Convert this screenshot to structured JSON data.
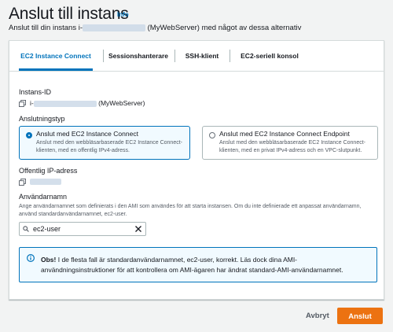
{
  "header": {
    "title": "Anslut till instans",
    "info_link": "Info",
    "subtitle_prefix": "Anslut till din instans i-",
    "subtitle_suffix": "(MyWebServer) med något av dessa alternativ"
  },
  "tabs": [
    {
      "label": "EC2 Instance Connect",
      "active": true
    },
    {
      "label": "Sessionshanterare",
      "active": false
    },
    {
      "label": "SSH-klient",
      "active": false
    },
    {
      "label": "EC2-seriell konsol",
      "active": false
    }
  ],
  "instance": {
    "label": "Instans-ID",
    "id_prefix": "i-",
    "name": "(MyWebServer)"
  },
  "connection_type": {
    "label": "Anslutningstyp",
    "options": [
      {
        "title": "Anslut med EC2 Instance Connect",
        "description": "Anslut med den webbläsarbaserade EC2 Instance Connect-klienten, med en offentlig IPv4-adress.",
        "selected": true
      },
      {
        "title": "Anslut med EC2 Instance Connect Endpoint",
        "description": "Anslut med den webbläsarbaserade EC2 Instance Connect-klienten, med en privat IPv4-adress och en VPC-slutpunkt.",
        "selected": false
      }
    ]
  },
  "public_ip": {
    "label": "Offentlig IP-adress"
  },
  "username": {
    "label": "Användarnamn",
    "description": "Ange användarnamnet som definierats i den AMI som användes för att starta instansen. Om du inte definierade ett anpassat användarnamn, använd standardanvändarnamnet, ec2-user.",
    "value": "ec2-user"
  },
  "alert": {
    "bold": "Obs!",
    "text": " I de flesta fall är standardanvändarnamnet, ec2-user, korrekt. Läs dock dina AMI-användningsinstruktioner för att kontrollera om AMI-ägaren har ändrat standard-AMI-användarnamnet."
  },
  "footer": {
    "cancel_label": "Avbryt",
    "connect_label": "Anslut"
  },
  "colors": {
    "accent": "#0073bb",
    "primary_button": "#ec7211",
    "background": "#f2f3f3"
  }
}
